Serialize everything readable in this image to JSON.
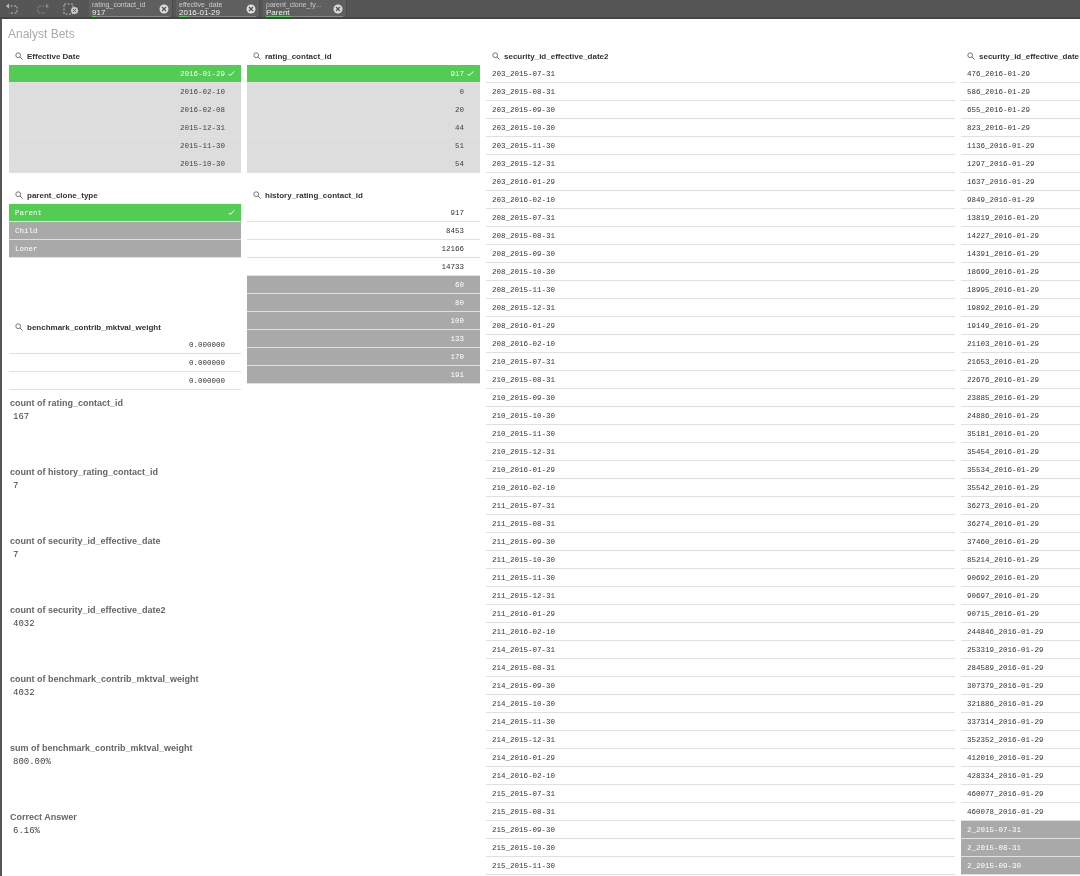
{
  "toolbar": {
    "chips": [
      {
        "field": "rating_contact_id",
        "value": "917",
        "level": 0.05
      },
      {
        "field": "effective_date",
        "value": "2016-01-29",
        "level": 0.1
      },
      {
        "field": "parent_clone_ty...",
        "value": "Parent",
        "level": 0.33
      }
    ]
  },
  "sheet": {
    "title": "Analyst Bets"
  },
  "panes": [
    {
      "title": "Effective Date",
      "kind": "numeric",
      "items": [
        {
          "value": "2016-01-29",
          "selected": true,
          "excluded": false
        },
        {
          "value": "2016-02-10",
          "selected": false,
          "excluded": false
        },
        {
          "value": "2016-02-08",
          "selected": false,
          "excluded": false
        },
        {
          "value": "2015-12-31",
          "selected": false,
          "excluded": false
        },
        {
          "value": "2015-11-30",
          "selected": false,
          "excluded": false
        },
        {
          "value": "2015-10-30",
          "selected": false,
          "excluded": false
        }
      ]
    },
    {
      "title": "rating_contact_id",
      "kind": "numeric",
      "items": [
        {
          "value": "917",
          "selected": true,
          "excluded": false
        },
        {
          "value": "0",
          "selected": false,
          "excluded": false
        },
        {
          "value": "20",
          "selected": false,
          "excluded": false
        },
        {
          "value": "44",
          "selected": false,
          "excluded": false
        },
        {
          "value": "51",
          "selected": false,
          "excluded": false
        },
        {
          "value": "54",
          "selected": false,
          "excluded": false
        }
      ]
    },
    {
      "title": "parent_clone_type",
      "kind": "text",
      "items": [
        {
          "value": "Parent",
          "selected": true,
          "excluded": false
        },
        {
          "value": "Child",
          "selected": false,
          "excluded": true
        },
        {
          "value": "Loner",
          "selected": false,
          "excluded": true
        }
      ]
    },
    {
      "title": "history_rating_contact_id",
      "kind": "numeric",
      "items": [
        {
          "value": "917",
          "selected": false,
          "excluded": false
        },
        {
          "value": "8453",
          "selected": false,
          "excluded": false
        },
        {
          "value": "12166",
          "selected": false,
          "excluded": false
        },
        {
          "value": "14733",
          "selected": false,
          "excluded": false
        },
        {
          "value": "60",
          "selected": false,
          "excluded": true
        },
        {
          "value": "80",
          "selected": false,
          "excluded": true
        },
        {
          "value": "100",
          "selected": false,
          "excluded": true
        },
        {
          "value": "133",
          "selected": false,
          "excluded": true
        },
        {
          "value": "170",
          "selected": false,
          "excluded": true
        },
        {
          "value": "191",
          "selected": false,
          "excluded": true
        }
      ]
    },
    {
      "title": "benchmark_contrib_mktval_weight",
      "kind": "numeric",
      "items": [
        {
          "value": "0.000000",
          "selected": false,
          "excluded": false
        },
        {
          "value": "0.000000",
          "selected": false,
          "excluded": false
        },
        {
          "value": "0.000000",
          "selected": false,
          "excluded": false
        }
      ]
    },
    {
      "title": "security_id_effective_date2",
      "kind": "text",
      "items": [
        {
          "value": "203_2015-07-31",
          "selected": false,
          "excluded": false
        },
        {
          "value": "203_2015-08-31",
          "selected": false,
          "excluded": false
        },
        {
          "value": "203_2015-09-30",
          "selected": false,
          "excluded": false
        },
        {
          "value": "203_2015-10-30",
          "selected": false,
          "excluded": false
        },
        {
          "value": "203_2015-11-30",
          "selected": false,
          "excluded": false
        },
        {
          "value": "203_2015-12-31",
          "selected": false,
          "excluded": false
        },
        {
          "value": "203_2016-01-29",
          "selected": false,
          "excluded": false
        },
        {
          "value": "203_2016-02-10",
          "selected": false,
          "excluded": false
        },
        {
          "value": "208_2015-07-31",
          "selected": false,
          "excluded": false
        },
        {
          "value": "208_2015-08-31",
          "selected": false,
          "excluded": false
        },
        {
          "value": "208_2015-09-30",
          "selected": false,
          "excluded": false
        },
        {
          "value": "208_2015-10-30",
          "selected": false,
          "excluded": false
        },
        {
          "value": "208_2015-11-30",
          "selected": false,
          "excluded": false
        },
        {
          "value": "208_2015-12-31",
          "selected": false,
          "excluded": false
        },
        {
          "value": "208_2016-01-29",
          "selected": false,
          "excluded": false
        },
        {
          "value": "208_2016-02-10",
          "selected": false,
          "excluded": false
        },
        {
          "value": "210_2015-07-31",
          "selected": false,
          "excluded": false
        },
        {
          "value": "210_2015-08-31",
          "selected": false,
          "excluded": false
        },
        {
          "value": "210_2015-09-30",
          "selected": false,
          "excluded": false
        },
        {
          "value": "210_2015-10-30",
          "selected": false,
          "excluded": false
        },
        {
          "value": "210_2015-11-30",
          "selected": false,
          "excluded": false
        },
        {
          "value": "210_2015-12-31",
          "selected": false,
          "excluded": false
        },
        {
          "value": "210_2016-01-29",
          "selected": false,
          "excluded": false
        },
        {
          "value": "210_2016-02-10",
          "selected": false,
          "excluded": false
        },
        {
          "value": "211_2015-07-31",
          "selected": false,
          "excluded": false
        },
        {
          "value": "211_2015-08-31",
          "selected": false,
          "excluded": false
        },
        {
          "value": "211_2015-09-30",
          "selected": false,
          "excluded": false
        },
        {
          "value": "211_2015-10-30",
          "selected": false,
          "excluded": false
        },
        {
          "value": "211_2015-11-30",
          "selected": false,
          "excluded": false
        },
        {
          "value": "211_2015-12-31",
          "selected": false,
          "excluded": false
        },
        {
          "value": "211_2016-01-29",
          "selected": false,
          "excluded": false
        },
        {
          "value": "211_2016-02-10",
          "selected": false,
          "excluded": false
        },
        {
          "value": "214_2015-07-31",
          "selected": false,
          "excluded": false
        },
        {
          "value": "214_2015-08-31",
          "selected": false,
          "excluded": false
        },
        {
          "value": "214_2015-09-30",
          "selected": false,
          "excluded": false
        },
        {
          "value": "214_2015-10-30",
          "selected": false,
          "excluded": false
        },
        {
          "value": "214_2015-11-30",
          "selected": false,
          "excluded": false
        },
        {
          "value": "214_2015-12-31",
          "selected": false,
          "excluded": false
        },
        {
          "value": "214_2016-01-29",
          "selected": false,
          "excluded": false
        },
        {
          "value": "214_2016-02-10",
          "selected": false,
          "excluded": false
        },
        {
          "value": "215_2015-07-31",
          "selected": false,
          "excluded": false
        },
        {
          "value": "215_2015-08-31",
          "selected": false,
          "excluded": false
        },
        {
          "value": "215_2015-09-30",
          "selected": false,
          "excluded": false
        },
        {
          "value": "215_2015-10-30",
          "selected": false,
          "excluded": false
        },
        {
          "value": "215_2015-11-30",
          "selected": false,
          "excluded": false
        }
      ]
    },
    {
      "title": "security_id_effective_date",
      "kind": "text",
      "items": [
        {
          "value": "476_2016-01-29",
          "selected": false,
          "excluded": false
        },
        {
          "value": "586_2016-01-29",
          "selected": false,
          "excluded": false
        },
        {
          "value": "655_2016-01-29",
          "selected": false,
          "excluded": false
        },
        {
          "value": "823_2016-01-29",
          "selected": false,
          "excluded": false
        },
        {
          "value": "1136_2016-01-29",
          "selected": false,
          "excluded": false
        },
        {
          "value": "1297_2016-01-29",
          "selected": false,
          "excluded": false
        },
        {
          "value": "1637_2016-01-29",
          "selected": false,
          "excluded": false
        },
        {
          "value": "9849_2016-01-29",
          "selected": false,
          "excluded": false
        },
        {
          "value": "13819_2016-01-29",
          "selected": false,
          "excluded": false
        },
        {
          "value": "14227_2016-01-29",
          "selected": false,
          "excluded": false
        },
        {
          "value": "14391_2016-01-29",
          "selected": false,
          "excluded": false
        },
        {
          "value": "18699_2016-01-29",
          "selected": false,
          "excluded": false
        },
        {
          "value": "18995_2016-01-29",
          "selected": false,
          "excluded": false
        },
        {
          "value": "19892_2016-01-29",
          "selected": false,
          "excluded": false
        },
        {
          "value": "19149_2016-01-29",
          "selected": false,
          "excluded": false
        },
        {
          "value": "21103_2016-01-29",
          "selected": false,
          "excluded": false
        },
        {
          "value": "21653_2016-01-29",
          "selected": false,
          "excluded": false
        },
        {
          "value": "22676_2016-01-29",
          "selected": false,
          "excluded": false
        },
        {
          "value": "23885_2016-01-29",
          "selected": false,
          "excluded": false
        },
        {
          "value": "24886_2016-01-29",
          "selected": false,
          "excluded": false
        },
        {
          "value": "35181_2016-01-29",
          "selected": false,
          "excluded": false
        },
        {
          "value": "35454_2016-01-29",
          "selected": false,
          "excluded": false
        },
        {
          "value": "35534_2016-01-29",
          "selected": false,
          "excluded": false
        },
        {
          "value": "35542_2016-01-29",
          "selected": false,
          "excluded": false
        },
        {
          "value": "36273_2016-01-29",
          "selected": false,
          "excluded": false
        },
        {
          "value": "36274_2016-01-29",
          "selected": false,
          "excluded": false
        },
        {
          "value": "37460_2016-01-29",
          "selected": false,
          "excluded": false
        },
        {
          "value": "85214_2016-01-29",
          "selected": false,
          "excluded": false
        },
        {
          "value": "90692_2016-01-29",
          "selected": false,
          "excluded": false
        },
        {
          "value": "90697_2016-01-29",
          "selected": false,
          "excluded": false
        },
        {
          "value": "90715_2016-01-29",
          "selected": false,
          "excluded": false
        },
        {
          "value": "244846_2016-01-29",
          "selected": false,
          "excluded": false
        },
        {
          "value": "253319_2016-01-29",
          "selected": false,
          "excluded": false
        },
        {
          "value": "284589_2016-01-29",
          "selected": false,
          "excluded": false
        },
        {
          "value": "307379_2016-01-29",
          "selected": false,
          "excluded": false
        },
        {
          "value": "321886_2016-01-29",
          "selected": false,
          "excluded": false
        },
        {
          "value": "337314_2016-01-29",
          "selected": false,
          "excluded": false
        },
        {
          "value": "352352_2016-01-29",
          "selected": false,
          "excluded": false
        },
        {
          "value": "412010_2016-01-29",
          "selected": false,
          "excluded": false
        },
        {
          "value": "428334_2016-01-29",
          "selected": false,
          "excluded": false
        },
        {
          "value": "460077_2016-01-29",
          "selected": false,
          "excluded": false
        },
        {
          "value": "460078_2016-01-29",
          "selected": false,
          "excluded": false
        },
        {
          "value": "2_2015-07-31",
          "selected": false,
          "excluded": true
        },
        {
          "value": "2_2015-08-31",
          "selected": false,
          "excluded": true
        },
        {
          "value": "2_2015-09-30",
          "selected": false,
          "excluded": true
        }
      ]
    }
  ],
  "kpis": [
    {
      "label": "count of rating_contact_id",
      "value": "167"
    },
    {
      "label": "count of history_rating_contact_id",
      "value": "7"
    },
    {
      "label": "count of security_id_effective_date",
      "value": "7"
    },
    {
      "label": "count of security_id_effective_date2",
      "value": "4032"
    },
    {
      "label": "count of benchmark_contrib_mktval_weight",
      "value": "4032"
    },
    {
      "label": "sum of benchmark_contrib_mktval_weight",
      "value": "800.00%"
    },
    {
      "label": "Correct Answer",
      "value": "6.16%"
    }
  ]
}
